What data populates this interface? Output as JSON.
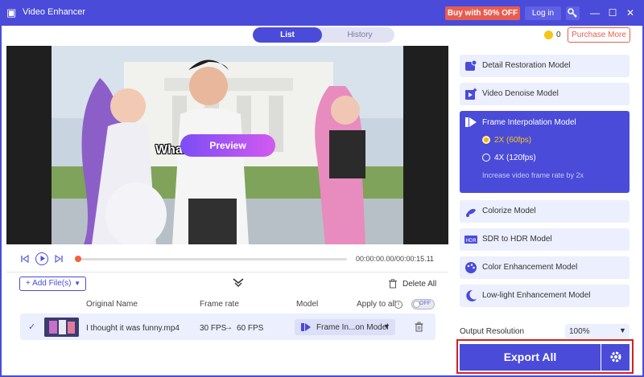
{
  "app": {
    "title": "Video Enhancer"
  },
  "titlebar": {
    "buy_label": "Buy with 50% OFF",
    "login_label": "Log in",
    "minimize": "—",
    "maximize": "☐",
    "close": "✕"
  },
  "tabs": [
    {
      "label": "List",
      "active": true
    },
    {
      "label": "History",
      "active": false
    }
  ],
  "account": {
    "coins": "0",
    "purchase_label": "Purchase More"
  },
  "video": {
    "subtitle": "What... ...ch now:",
    "preview_label": "Preview"
  },
  "player": {
    "time": "00:00:00.00/00:00:15.11",
    "progress": 0
  },
  "filelist": {
    "add_label": "+ Add File(s)",
    "delete_all_label": "Delete All",
    "headers": {
      "original_name": "Original Name",
      "frame_rate": "Frame rate",
      "model": "Model",
      "apply_to_all": "Apply to all"
    },
    "toggle_label": "OFF",
    "rows": [
      {
        "name": "I thought it was funny.mp4",
        "fps_from": "30 FPS",
        "fps_to": "60 FPS",
        "model": "Frame In...on Model",
        "checked": true
      }
    ]
  },
  "models": {
    "items": [
      {
        "label": "Detail Restoration Model",
        "icon": "detail-restore-icon"
      },
      {
        "label": "Video Denoise Model",
        "icon": "denoise-icon"
      },
      {
        "label": "Frame Interpolation Model",
        "icon": "frame-interpolation-icon",
        "active": true
      },
      {
        "label": "Colorize Model",
        "icon": "colorize-icon"
      },
      {
        "label": "SDR to HDR Model",
        "icon": "hdr-icon"
      },
      {
        "label": "Color Enhancement Model",
        "icon": "palette-icon"
      },
      {
        "label": "Low-light Enhancement Model",
        "icon": "moon-icon"
      }
    ],
    "frame_options": [
      {
        "label": "2X (60fps)",
        "selected": true
      },
      {
        "label": "4X (120fps)",
        "selected": false
      }
    ],
    "frame_hint": "Increase video frame rate by 2x"
  },
  "output": {
    "label": "Output Resolution",
    "value": "100%"
  },
  "export": {
    "label": "Export All"
  },
  "colors": {
    "accent": "#4a4bd8",
    "buy": "#e85d50",
    "progress": "#f0633a"
  }
}
